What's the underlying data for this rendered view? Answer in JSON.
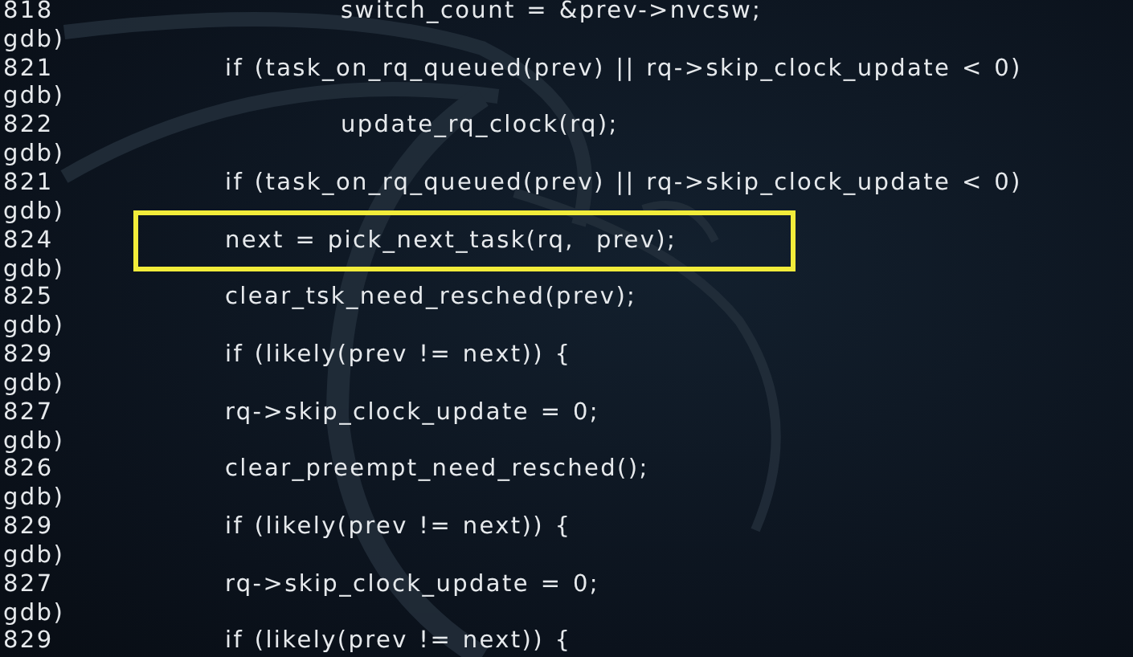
{
  "terminal": {
    "lines": [
      {
        "kind": "source",
        "number": "818",
        "code": "switch_count = &prev->nvcsw;",
        "indented": true,
        "highlighted": false
      },
      {
        "kind": "prompt",
        "text": "gdb)"
      },
      {
        "kind": "source",
        "number": "821",
        "code": "if (task_on_rq_queued(prev) || rq->skip_clock_update < 0)",
        "indented": false,
        "highlighted": false
      },
      {
        "kind": "prompt",
        "text": "gdb)"
      },
      {
        "kind": "source",
        "number": "822",
        "code": "update_rq_clock(rq);",
        "indented": true,
        "highlighted": false
      },
      {
        "kind": "prompt",
        "text": "gdb)"
      },
      {
        "kind": "source",
        "number": "821",
        "code": "if (task_on_rq_queued(prev) || rq->skip_clock_update < 0)",
        "indented": false,
        "highlighted": false
      },
      {
        "kind": "prompt",
        "text": "gdb)"
      },
      {
        "kind": "source",
        "number": "824",
        "code": "next = pick_next_task(rq,  prev);",
        "indented": false,
        "highlighted": true
      },
      {
        "kind": "prompt",
        "text": "gdb)"
      },
      {
        "kind": "source",
        "number": "825",
        "code": "clear_tsk_need_resched(prev);",
        "indented": false,
        "highlighted": false
      },
      {
        "kind": "prompt",
        "text": "gdb)"
      },
      {
        "kind": "source",
        "number": "829",
        "code": "if (likely(prev != next)) {",
        "indented": false,
        "highlighted": false
      },
      {
        "kind": "prompt",
        "text": "gdb)"
      },
      {
        "kind": "source",
        "number": "827",
        "code": "rq->skip_clock_update = 0;",
        "indented": false,
        "highlighted": false
      },
      {
        "kind": "prompt",
        "text": "gdb)"
      },
      {
        "kind": "source",
        "number": "826",
        "code": "clear_preempt_need_resched();",
        "indented": false,
        "highlighted": false
      },
      {
        "kind": "prompt",
        "text": "gdb)"
      },
      {
        "kind": "source",
        "number": "829",
        "code": "if (likely(prev != next)) {",
        "indented": false,
        "highlighted": false
      },
      {
        "kind": "prompt",
        "text": "gdb)"
      },
      {
        "kind": "source",
        "number": "827",
        "code": "rq->skip_clock_update = 0;",
        "indented": false,
        "highlighted": false
      },
      {
        "kind": "prompt",
        "text": "gdb)"
      },
      {
        "kind": "source",
        "number": "829",
        "code": "if (likely(prev != next)) {",
        "indented": false,
        "highlighted": false
      }
    ]
  }
}
